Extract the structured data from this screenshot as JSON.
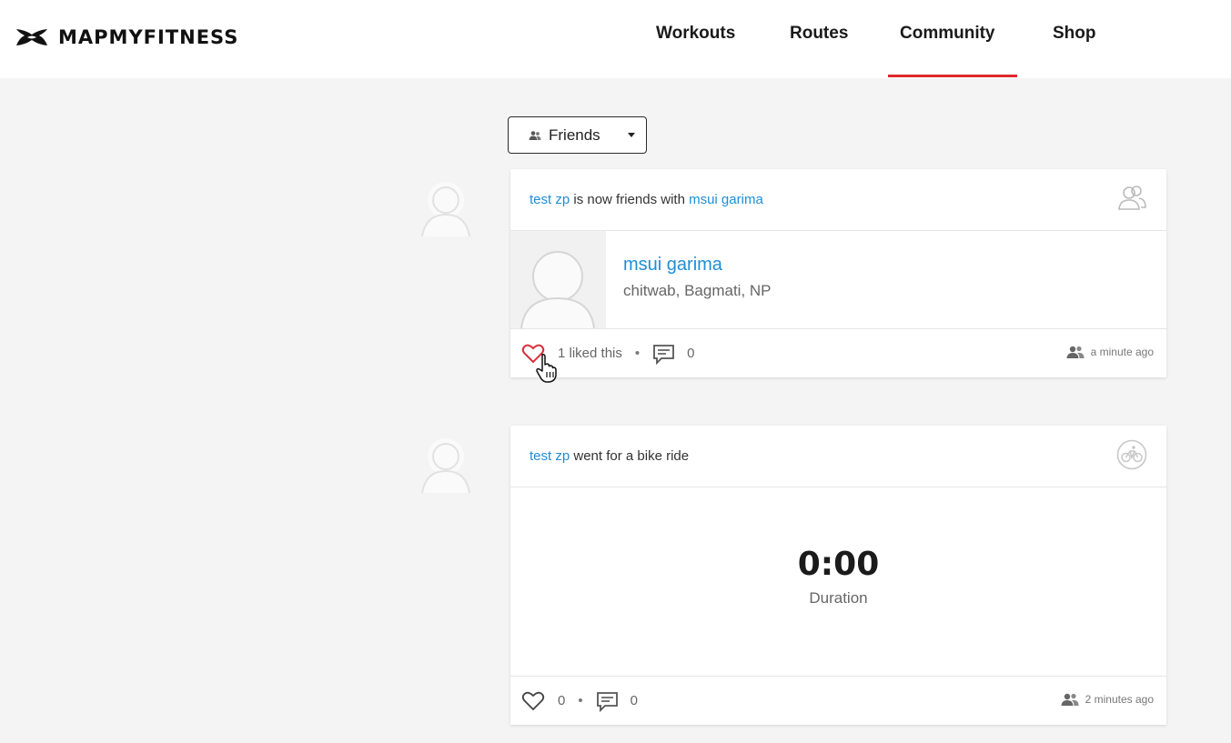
{
  "brand": {
    "name": "MAPMYFITNESS"
  },
  "nav": {
    "items": [
      {
        "label": "Workouts"
      },
      {
        "label": "Routes"
      },
      {
        "label": "Community",
        "active": true
      },
      {
        "label": "Shop"
      }
    ],
    "accent_color": "#e02a2a"
  },
  "filter": {
    "label": "Friends",
    "icon": "people-icon"
  },
  "colors": {
    "link": "#1f8ed6",
    "background": "#f4f4f4",
    "heart_active": "#d9303a"
  },
  "feed": [
    {
      "type": "friendship",
      "actor": "test zp",
      "action": "is now friends with",
      "target": "msui garima",
      "header_icon": "friends-icon",
      "friend": {
        "name": "msui garima",
        "location": "chitwab, Bagmati, NP"
      },
      "likes_text": "1 liked this",
      "comment_count": "0",
      "time": "a minute ago",
      "liked": true
    },
    {
      "type": "workout",
      "actor": "test zp",
      "action": "went for a bike ride",
      "header_icon": "bike-icon",
      "duration_value": "0:00",
      "duration_label": "Duration",
      "like_count": "0",
      "comment_count": "0",
      "time": "2 minutes ago",
      "liked": false
    }
  ]
}
